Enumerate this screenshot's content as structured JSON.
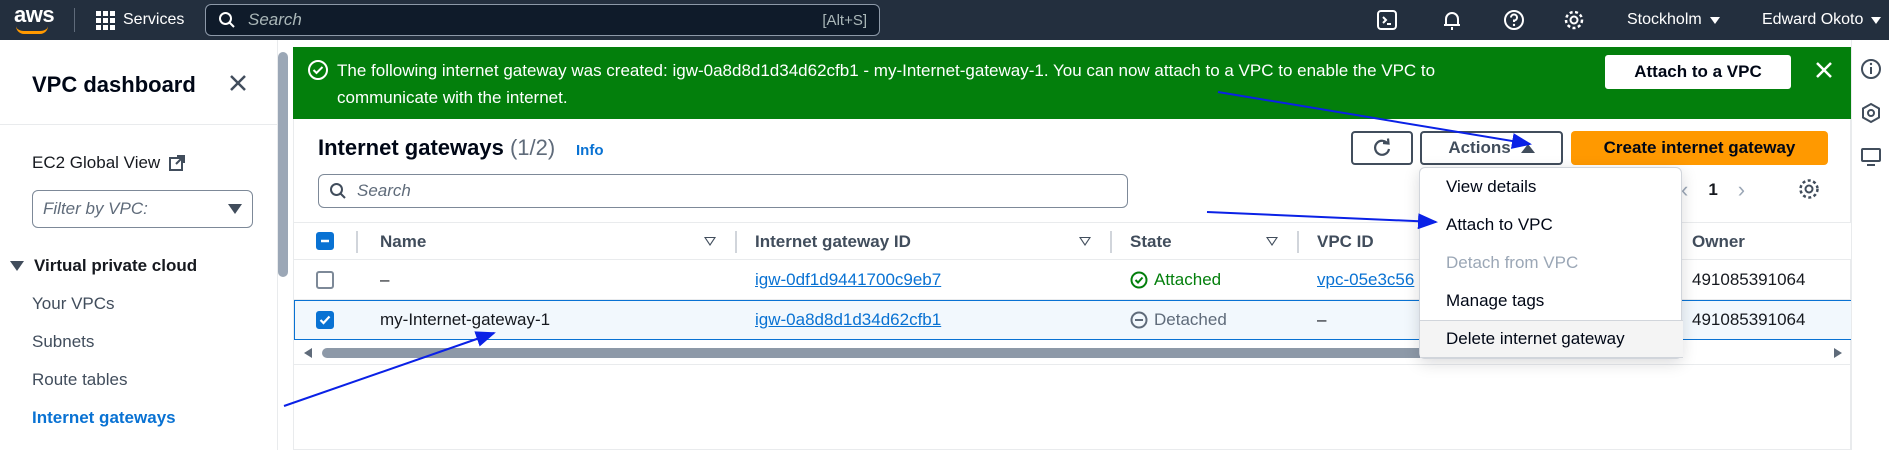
{
  "topbar": {
    "logo": "aws",
    "services_label": "Services",
    "search_placeholder": "Search",
    "search_shortcut": "[Alt+S]",
    "region": "Stockholm",
    "user": "Edward Okoto"
  },
  "sidebar": {
    "title": "VPC dashboard",
    "ec2_link": "EC2 Global View",
    "filter_placeholder": "Filter by VPC:",
    "section": "Virtual private cloud",
    "items": [
      "Your VPCs",
      "Subnets",
      "Route tables",
      "Internet gateways"
    ],
    "active_item": "Internet gateways"
  },
  "flash": {
    "message": "The following internet gateway was created: igw-0a8d8d1d34d62cfb1 - my-Internet-gateway-1. You can now attach to a VPC to enable the VPC to communicate with the internet.",
    "button": "Attach to a VPC",
    "color": "#037f0c"
  },
  "header": {
    "title": "Internet gateways",
    "count": "(1/2)",
    "info": "Info",
    "actions_label": "Actions",
    "create_label": "Create internet gateway"
  },
  "table": {
    "search_placeholder": "Search",
    "page": "1",
    "columns": [
      "Name",
      "Internet gateway ID",
      "State",
      "VPC ID",
      "Owner"
    ],
    "rows": [
      {
        "name": "–",
        "id": "igw-0df1d9441700c9eb7",
        "state": "Attached",
        "vpc": "vpc-05e3c56",
        "owner": "491085391064",
        "selected": false
      },
      {
        "name": "my-Internet-gateway-1",
        "id": "igw-0a8d8d1d34d62cfb1",
        "state": "Detached",
        "vpc": "–",
        "owner": "491085391064",
        "selected": true
      }
    ]
  },
  "actions_menu": {
    "items": [
      "View details",
      "Attach to VPC",
      "Detach from VPC",
      "Manage tags",
      "Delete internet gateway"
    ],
    "disabled": [
      "Detach from VPC"
    ]
  },
  "colors": {
    "accent": "#0972d3",
    "primary_button": "#ff9900",
    "topbar": "#232f3e",
    "annotation_arrow": "#0a21e6"
  }
}
